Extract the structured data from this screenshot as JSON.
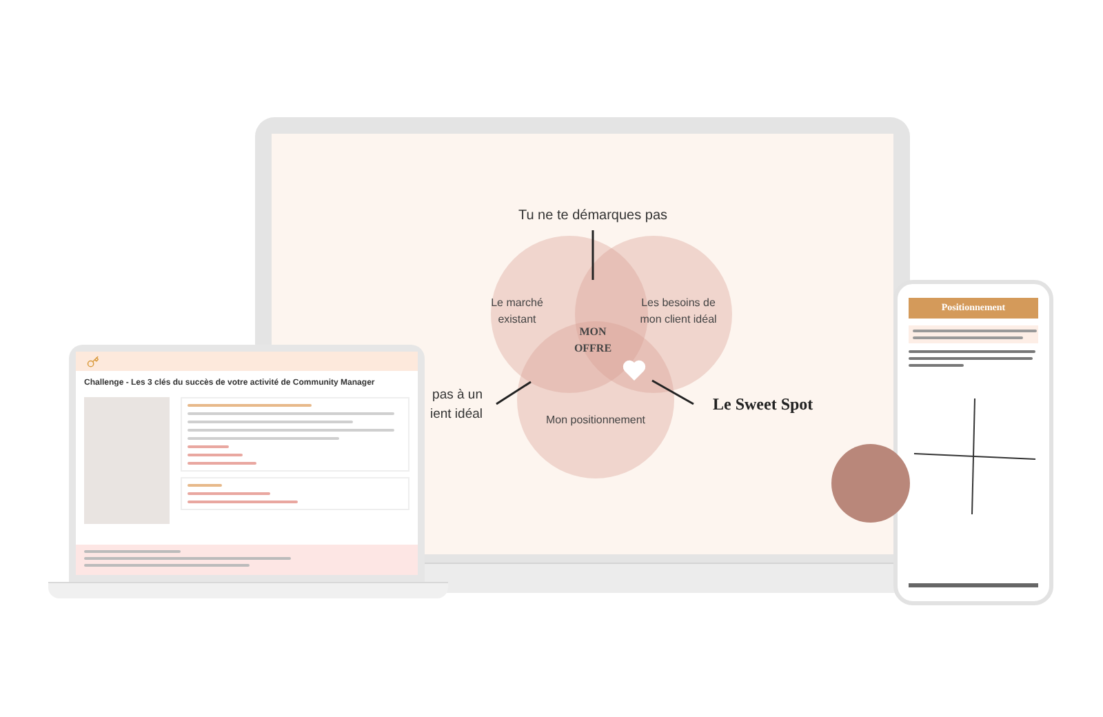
{
  "slide": {
    "top_label": "Tu ne te démarques pas",
    "circles": [
      {
        "lines": [
          "Le marché",
          "existant"
        ]
      },
      {
        "lines": [
          "Les besoins de",
          "mon client idéal"
        ]
      },
      {
        "lines": [
          "Mon positionnement"
        ]
      }
    ],
    "center_lines": [
      "MON",
      "OFFRE"
    ],
    "left_label_lines": [
      "pas à un",
      "ient idéal"
    ],
    "right_label": "Le Sweet Spot"
  },
  "course_page": {
    "title": "Challenge - Les 3 clés du succès de votre activité de Community Manager"
  },
  "phone": {
    "header": "Positionnement"
  }
}
